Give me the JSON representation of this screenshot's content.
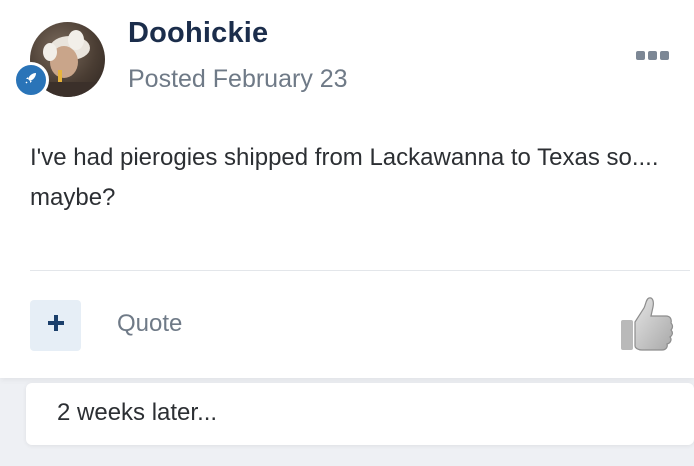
{
  "post": {
    "author": "Doohickie",
    "posted": "Posted February 23",
    "body": "I've had pierogies shipped from Lackawanna to Texas so.... maybe?",
    "actions": {
      "multiquote_symbol": "+",
      "quote_label": "Quote"
    }
  },
  "time_gap": {
    "text": "2 weeks later..."
  },
  "icons": {
    "rank_badge": "rocket-icon",
    "menu": "ellipsis-icon",
    "reaction": "thumbs-up-icon"
  },
  "colors": {
    "author_name": "#1b2d4b",
    "muted_text": "#6f7a87",
    "badge": "#2a74b8",
    "multiquote_bg": "#e6eef6",
    "page_bg": "#eef0f4"
  }
}
